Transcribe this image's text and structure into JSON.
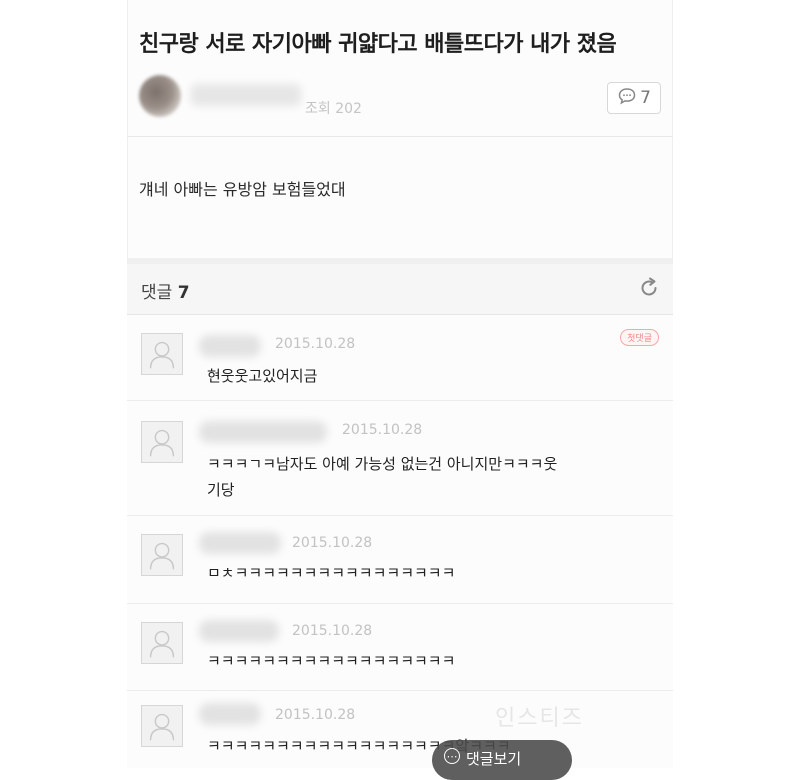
{
  "post": {
    "title": "친구랑 서로 자기아빠 귀얇다고 배틀뜨다가 내가 졌음",
    "views": "조회 202",
    "comment_count": "7",
    "body": "걔네 아빠는 유방암 보험들었대"
  },
  "comments_section": {
    "label": "댓글",
    "count": "7"
  },
  "comments": [
    {
      "date": "2015.10.28",
      "badge": "첫댓글",
      "lines": [
        "현웃웃고있어지금"
      ]
    },
    {
      "date": "2015.10.28",
      "lines": [
        "ㅋㅋㅋㄱㅋ남자도 아예 가능성 없는건 아니지만ㅋㅋㅋ웃",
        "기당"
      ]
    },
    {
      "date": "2015.10.28",
      "lines": [
        "ㅁㅊㅋㅋㅋㅋㅋㅋㅋㅋㅋㅋㅋㅋㅋㅋㅋㅋ"
      ]
    },
    {
      "date": "2015.10.28",
      "lines": [
        "ㅋㅋㅋㅋㅋㅋㅋㅋㅋㅋㅋㅋㅋㅋㅋㅋㅋㅋ"
      ]
    },
    {
      "date": "2015.10.28",
      "lines": [
        "ㅋㅋㅋㅋㅋㅋㅋㅋㅋㅋㅋㅋㅋㅋㅋㅋㅋㅋ앜ㅋㅋㅋ"
      ]
    }
  ],
  "watermark": "인스티즈",
  "more_button": {
    "label": "댓글보기"
  },
  "icons": {
    "comment": "speech-bubble-icon",
    "refresh": "refresh-icon",
    "avatar": "default-user-icon"
  },
  "colors": {
    "background": "#fcfcfc",
    "badge": "#e88888",
    "date": "#c2c2c2"
  }
}
